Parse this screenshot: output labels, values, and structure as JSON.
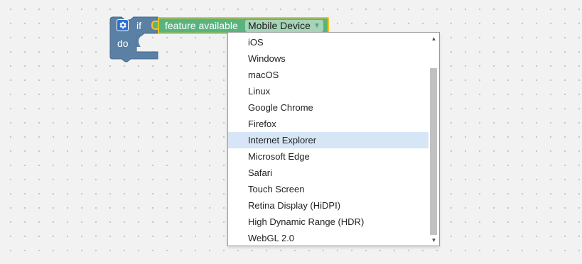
{
  "if_block": {
    "if_label": "if",
    "do_label": "do",
    "color": "#5b80a5",
    "mutator_icon": "gear-icon"
  },
  "feature_block": {
    "label": "feature available",
    "selected_option": "Mobile Device",
    "dropdown_arrow": "▼",
    "color": "#59b37f",
    "highlight_color": "#f7c21a"
  },
  "dropdown_menu": {
    "highlighted_index": 6,
    "highlight_color": "#d6e6f7",
    "items": [
      {
        "label": "iOS"
      },
      {
        "label": "Windows"
      },
      {
        "label": "macOS"
      },
      {
        "label": "Linux"
      },
      {
        "label": "Google Chrome"
      },
      {
        "label": "Firefox"
      },
      {
        "label": "Internet Explorer"
      },
      {
        "label": "Microsoft Edge"
      },
      {
        "label": "Safari"
      },
      {
        "label": "Touch Screen"
      },
      {
        "label": "Retina Display (HiDPI)"
      },
      {
        "label": "High Dynamic Range (HDR)"
      },
      {
        "label": "WebGL 2.0"
      }
    ],
    "scroll_up_icon": "▲",
    "scroll_down_icon": "▼"
  }
}
